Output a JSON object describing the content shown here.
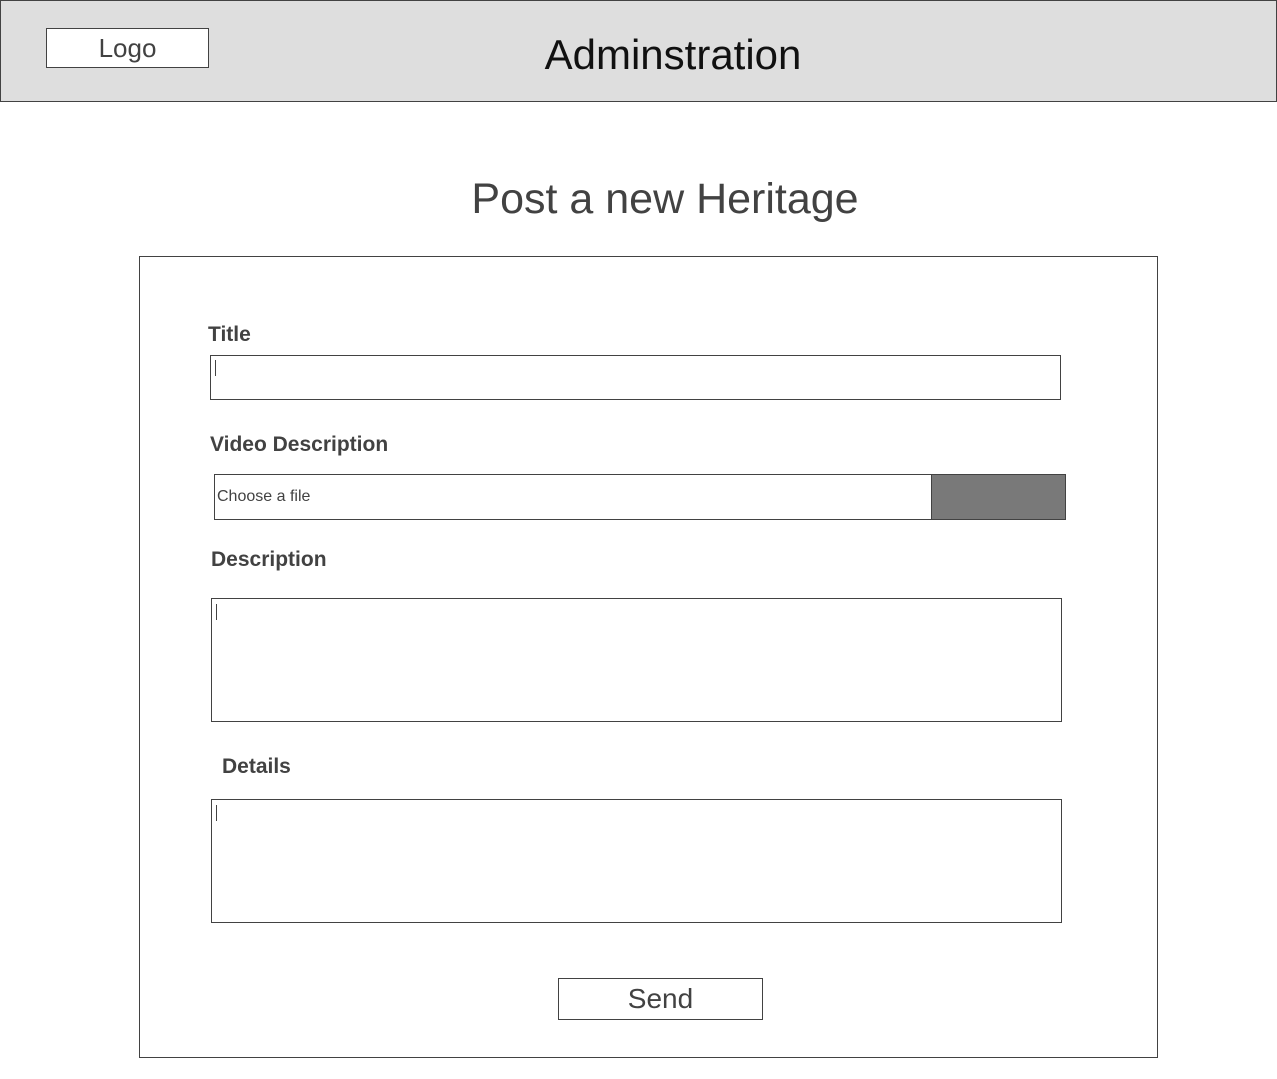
{
  "header": {
    "logo_label": "Logo",
    "title": "Adminstration"
  },
  "page": {
    "title": "Post a new Heritage"
  },
  "form": {
    "title_label": "Title",
    "title_value": "",
    "video_label": "Video Description",
    "video_placeholder": "Choose a file",
    "description_label": "Description",
    "description_value": "",
    "details_label": "Details",
    "details_value": "",
    "send_label": "Send"
  },
  "colors": {
    "header_bg": "#dedede",
    "border": "#424242",
    "file_button": "#797979"
  }
}
